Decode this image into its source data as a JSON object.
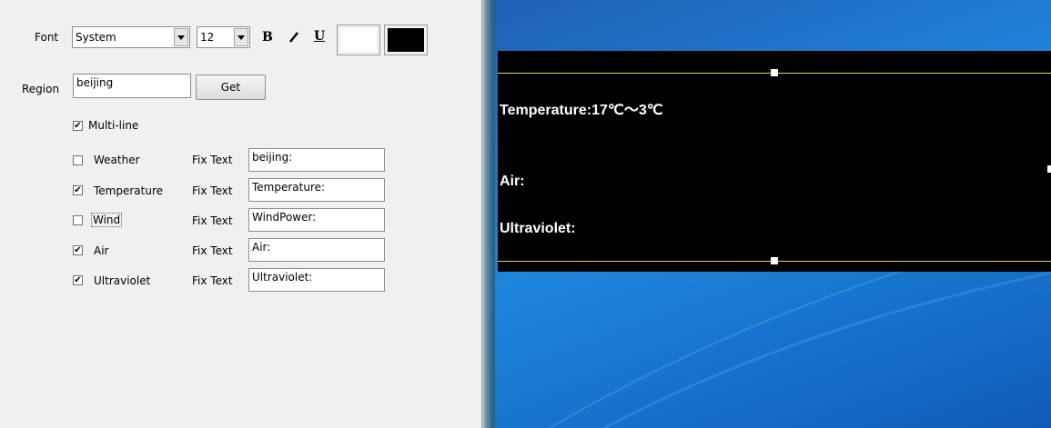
{
  "font_row": {
    "label": "Font",
    "family": "System",
    "size": "12",
    "bold": "B",
    "italic": "I",
    "underline": "U",
    "bg_color": "#ffffff",
    "fg_color": "#000000"
  },
  "region": {
    "label": "Region",
    "value": "beijing",
    "get_label": "Get"
  },
  "multiline": {
    "label": "Multi-line",
    "checked": true
  },
  "fix_text_label": "Fix Text",
  "items": [
    {
      "label": "Weather",
      "checked": false,
      "fix_text": "beijing:"
    },
    {
      "label": "Temperature",
      "checked": true,
      "fix_text": "Temperature:"
    },
    {
      "label": "Wind",
      "checked": false,
      "fix_text": "WindPower:"
    },
    {
      "label": "Air",
      "checked": true,
      "fix_text": "Air:"
    },
    {
      "label": "Ultraviolet",
      "checked": true,
      "fix_text": "Ultraviolet:"
    }
  ],
  "preview": {
    "line1": "Temperature:17℃～3℃",
    "line2": "Air:",
    "line3": "Ultraviolet:"
  }
}
